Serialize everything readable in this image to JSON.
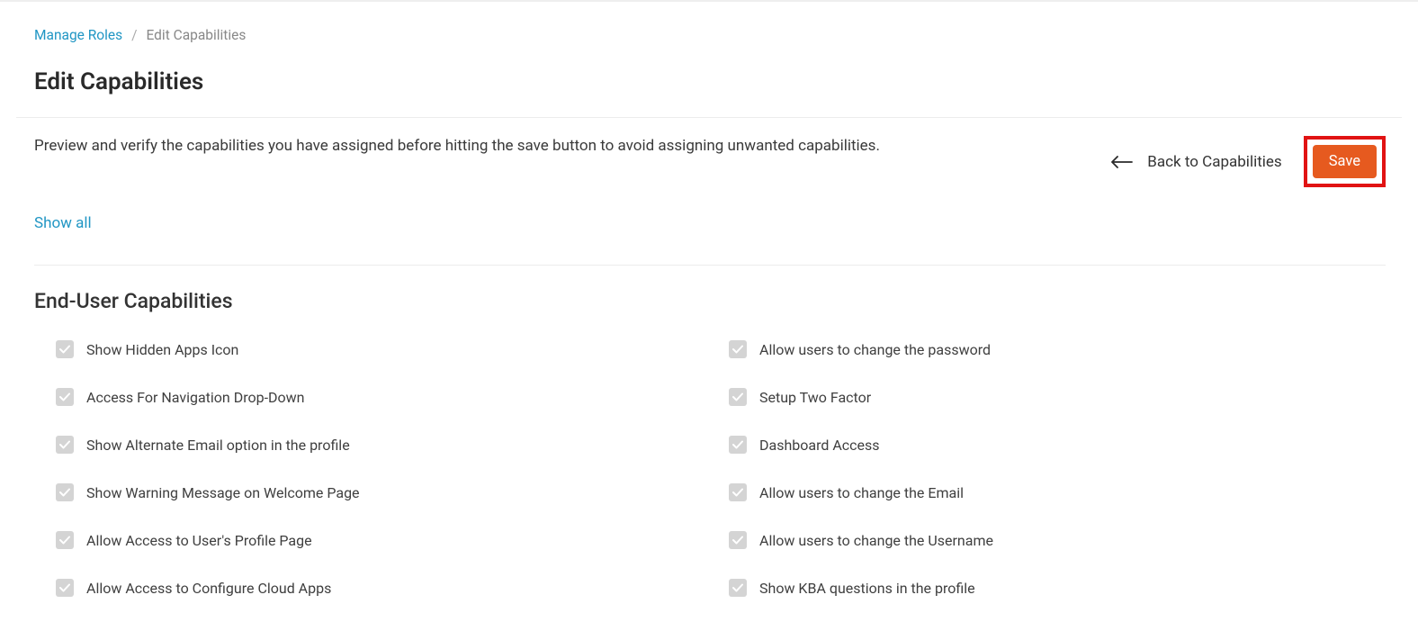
{
  "breadcrumb": {
    "link": "Manage Roles",
    "current": "Edit Capabilities"
  },
  "page_title": "Edit Capabilities",
  "description": "Preview and verify the capabilities you have assigned before hitting the save button to avoid assigning unwanted capabilities.",
  "actions": {
    "back_label": "Back to Capabilities",
    "save_label": "Save"
  },
  "show_all_label": "Show all",
  "section_title": "End-User Capabilities",
  "capabilities": {
    "left": [
      "Show Hidden Apps Icon",
      "Access For Navigation Drop-Down",
      "Show Alternate Email option in the profile",
      "Show Warning Message on Welcome Page",
      "Allow Access to User's Profile Page",
      "Allow Access to Configure Cloud Apps"
    ],
    "right": [
      "Allow users to change the password",
      "Setup Two Factor",
      "Dashboard Access",
      "Allow users to change the Email",
      "Allow users to change the Username",
      "Show KBA questions in the profile"
    ]
  }
}
